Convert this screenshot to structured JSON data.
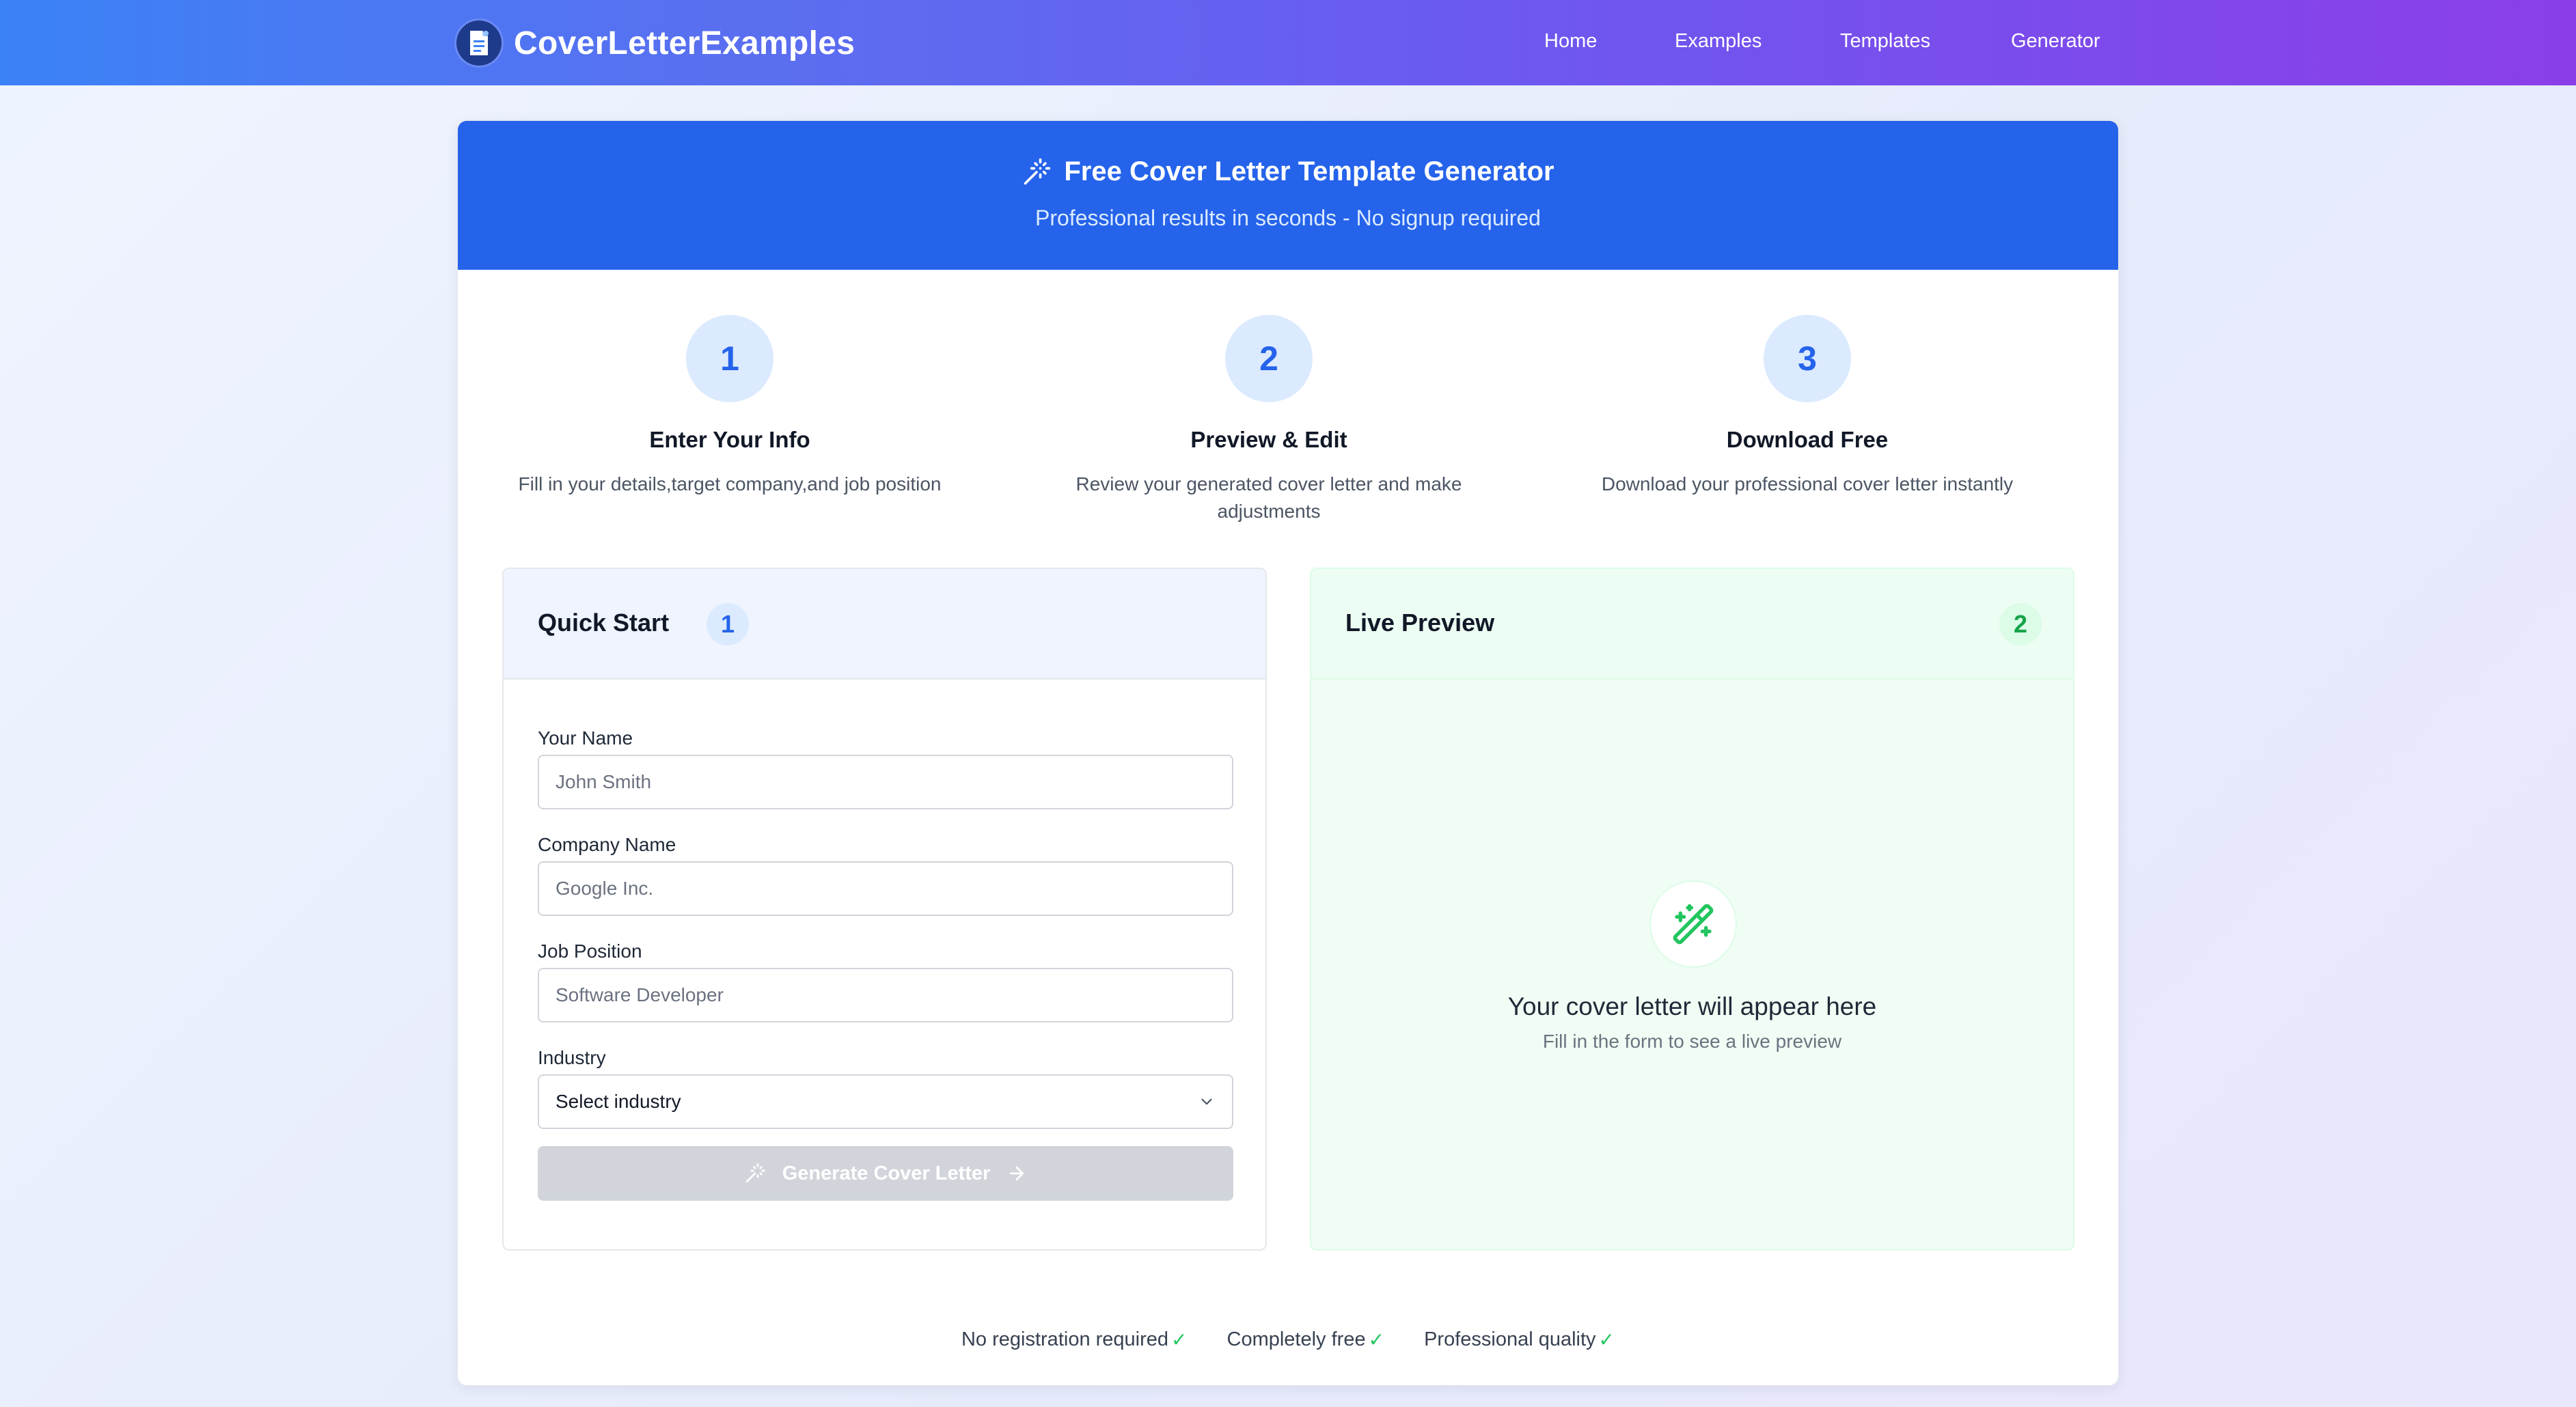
{
  "nav": {
    "brand": "CoverLetterExamples",
    "links": [
      "Home",
      "Examples",
      "Templates",
      "Generator"
    ]
  },
  "header": {
    "title": "Free Cover Letter Template Generator",
    "subtitle": "Professional results in seconds - No signup required"
  },
  "steps": [
    {
      "number": "1",
      "title": "Enter Your Info",
      "desc": "Fill in your details,target company,and job position"
    },
    {
      "number": "2",
      "title": "Preview & Edit",
      "desc": "Review your generated cover letter and make adjustments"
    },
    {
      "number": "3",
      "title": "Download Free",
      "desc": "Download your professional cover letter instantly"
    }
  ],
  "form": {
    "title": "Quick Start",
    "badge": "1",
    "name_label": "Your Name",
    "name_placeholder": "John Smith",
    "company_label": "Company Name",
    "company_placeholder": "Google Inc.",
    "position_label": "Job Position",
    "position_placeholder": "Software Developer",
    "industry_label": "Industry",
    "industry_value": "Select industry",
    "generate_label": "Generate Cover Letter"
  },
  "preview": {
    "title": "Live Preview",
    "badge": "2",
    "empty_title": "Your cover letter will appear here",
    "empty_subtitle": "Fill in the form to see a live preview"
  },
  "features": [
    {
      "label": "No registration required",
      "check": "✓"
    },
    {
      "label": "Completely free",
      "check": "✓"
    },
    {
      "label": "Professional quality",
      "check": "✓"
    }
  ],
  "colors": {
    "primary": "#2563eb",
    "success": "#22c55e",
    "disabled": "#d1d5db"
  }
}
